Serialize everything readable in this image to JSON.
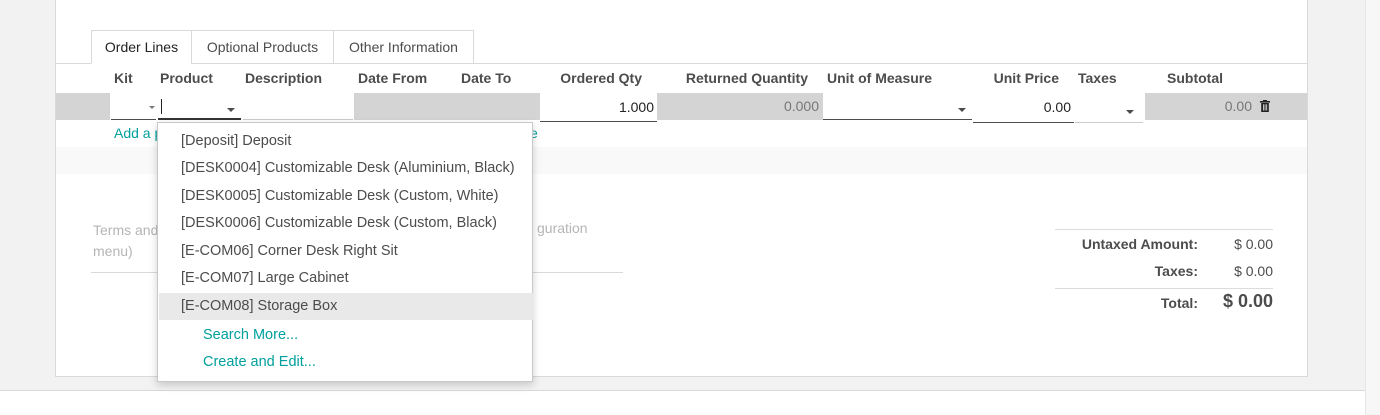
{
  "tabs": [
    {
      "label": "Order Lines",
      "active": true
    },
    {
      "label": "Optional Products",
      "active": false
    },
    {
      "label": "Other Information",
      "active": false
    }
  ],
  "columns": {
    "kit": "Kit",
    "product": "Product",
    "description": "Description",
    "date_from": "Date From",
    "date_to": "Date To",
    "ordered_qty": "Ordered Qty",
    "returned_quantity": "Returned Quantity",
    "unit_of_measure": "Unit of Measure",
    "unit_price": "Unit Price",
    "taxes": "Taxes",
    "subtotal": "Subtotal"
  },
  "line": {
    "product_value": "",
    "ordered_qty": "1.000",
    "returned_quantity": "0.000",
    "unit_price": "0.00",
    "subtotal": "0.00"
  },
  "add_line_partial": "Add a p",
  "add_line_tail": "e",
  "terms_placeholder_left_1": "Terms and",
  "terms_placeholder_left_2": "menu)",
  "terms_placeholder_right": "guration",
  "totals": {
    "untaxed_label": "Untaxed Amount:",
    "untaxed_value": "$ 0.00",
    "taxes_label": "Taxes:",
    "taxes_value": "$ 0.00",
    "total_label": "Total:",
    "total_value": "$ 0.00"
  },
  "dropdown": {
    "items": [
      "[Deposit] Deposit",
      "[DESK0004] Customizable Desk (Aluminium, Black)",
      "[DESK0005] Customizable Desk (Custom, White)",
      "[DESK0006] Customizable Desk (Custom, Black)",
      "[E-COM06] Corner Desk Right Sit",
      "[E-COM07] Large Cabinet",
      "[E-COM08] Storage Box"
    ],
    "highlighted_index": 6,
    "search_more": "Search More...",
    "create_and_edit": "Create and Edit..."
  },
  "colors": {
    "accent": "#00a09d",
    "readonly_bg": "#d4d4d4"
  }
}
